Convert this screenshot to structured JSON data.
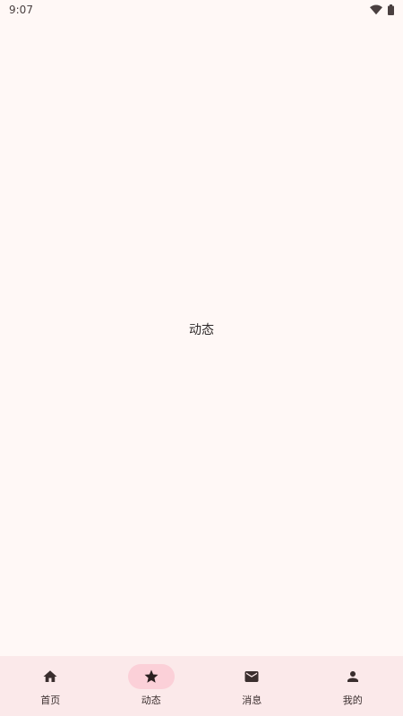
{
  "status_bar": {
    "time": "9:07",
    "icons": [
      "wifi-icon",
      "battery-icon"
    ]
  },
  "main": {
    "center_label": "动态"
  },
  "bottom_nav": {
    "active_index": 1,
    "accent_color": "#FBD0D8",
    "items": [
      {
        "label": "首页",
        "icon": "home-icon"
      },
      {
        "label": "动态",
        "icon": "star-icon"
      },
      {
        "label": "消息",
        "icon": "mail-icon"
      },
      {
        "label": "我的",
        "icon": "person-icon"
      }
    ]
  }
}
